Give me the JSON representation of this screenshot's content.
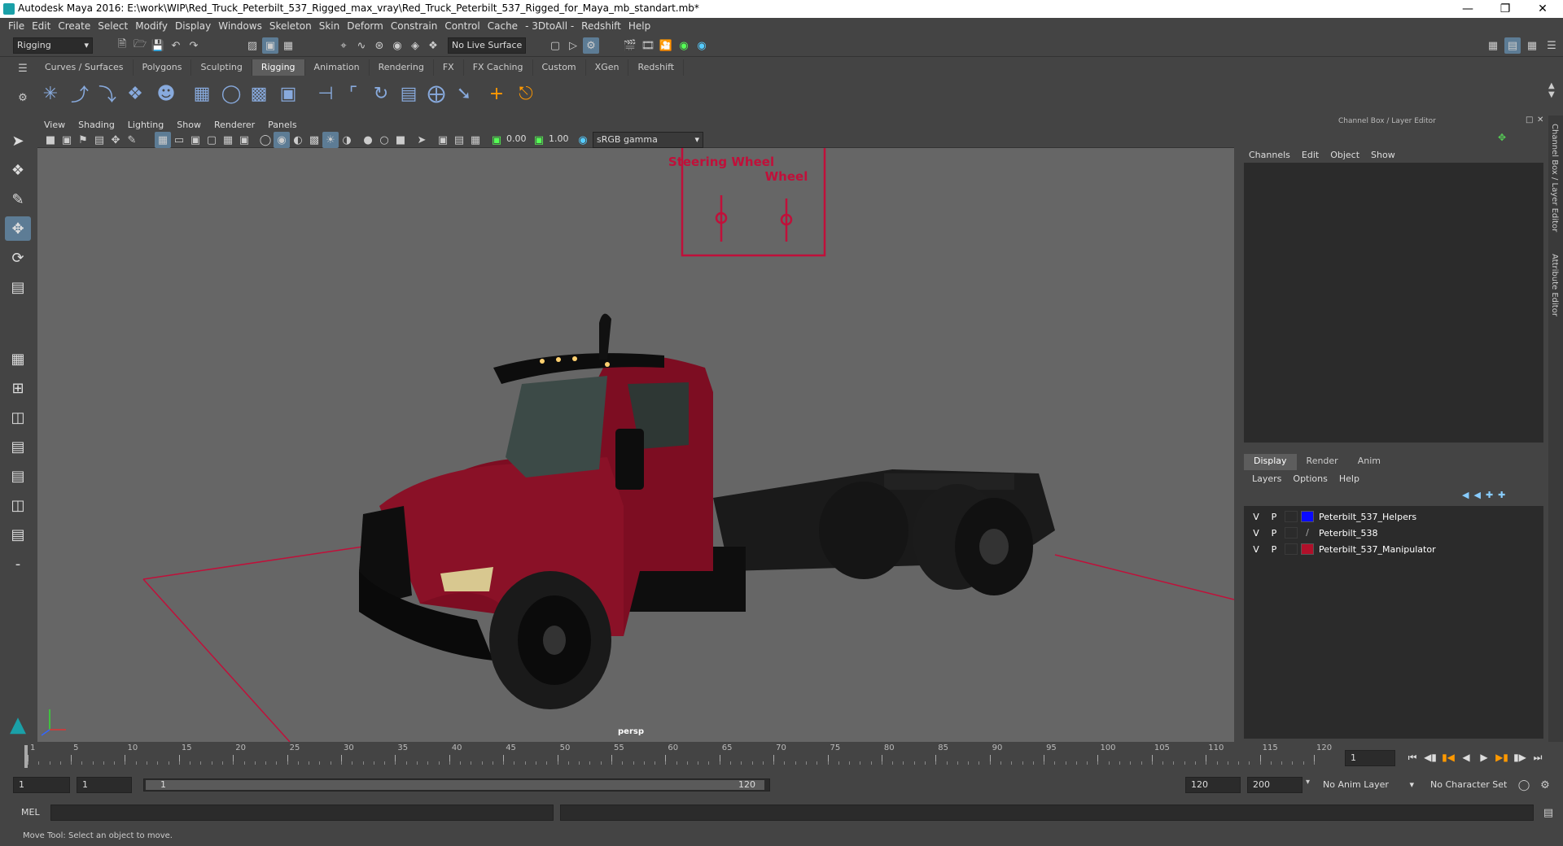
{
  "window": {
    "title": "Autodesk Maya 2016: E:\\work\\WIP\\Red_Truck_Peterbilt_537_Rigged_max_vray\\Red_Truck_Peterbilt_537_Rigged_for_Maya_mb_standart.mb*"
  },
  "menu": [
    "File",
    "Edit",
    "Create",
    "Select",
    "Modify",
    "Display",
    "Windows",
    "Skeleton",
    "Skin",
    "Deform",
    "Constrain",
    "Control",
    "Cache",
    "- 3DtoAll -",
    "Redshift",
    "Help"
  ],
  "status": {
    "mode": "Rigging",
    "live_surface": "No Live Surface"
  },
  "shelf_tabs": [
    "Curves / Surfaces",
    "Polygons",
    "Sculpting",
    "Rigging",
    "Animation",
    "Rendering",
    "FX",
    "FX Caching",
    "Custom",
    "XGen",
    "Redshift"
  ],
  "shelf_active": "Rigging",
  "viewport": {
    "menu": [
      "View",
      "Shading",
      "Lighting",
      "Show",
      "Renderer",
      "Panels"
    ],
    "exposure": "0.00",
    "gamma": "1.00",
    "colorspace": "sRGB gamma",
    "camera": "persp",
    "rig_label_steering": "Steering Wheel",
    "rig_label_wheel": "Wheel"
  },
  "channel_box": {
    "title": "Channel Box / Layer Editor",
    "menu": [
      "Channels",
      "Edit",
      "Object",
      "Show"
    ]
  },
  "layer_editor": {
    "tabs": [
      "Display",
      "Render",
      "Anim"
    ],
    "active_tab": "Display",
    "menu": [
      "Layers",
      "Options",
      "Help"
    ],
    "layers": [
      {
        "v": "V",
        "p": "P",
        "name": "Peterbilt_537_Helpers",
        "color": "#0a0aff"
      },
      {
        "v": "V",
        "p": "P",
        "name": "Peterbilt_538",
        "color": ""
      },
      {
        "v": "V",
        "p": "P",
        "name": "Peterbilt_537_Manipulator",
        "color": "#b0102a"
      }
    ]
  },
  "side_tabs": [
    "Channel Box / Layer Editor",
    "Attribute Editor"
  ],
  "timeline": {
    "ticks": [
      "1",
      "5",
      "10",
      "15",
      "20",
      "25",
      "30",
      "35",
      "40",
      "45",
      "50",
      "55",
      "60",
      "65",
      "70",
      "75",
      "80",
      "85",
      "90",
      "95",
      "100",
      "105",
      "110",
      "115",
      "120"
    ],
    "current_frame": "1"
  },
  "range": {
    "start": "1",
    "playback_start": "1",
    "slider_start": "1",
    "slider_end": "120",
    "playback_end": "120",
    "end": "200",
    "anim_layer": "No Anim Layer",
    "character_set": "No Character Set"
  },
  "mel": {
    "label": "MEL"
  },
  "help": {
    "text": "Move Tool: Select an object to move."
  }
}
